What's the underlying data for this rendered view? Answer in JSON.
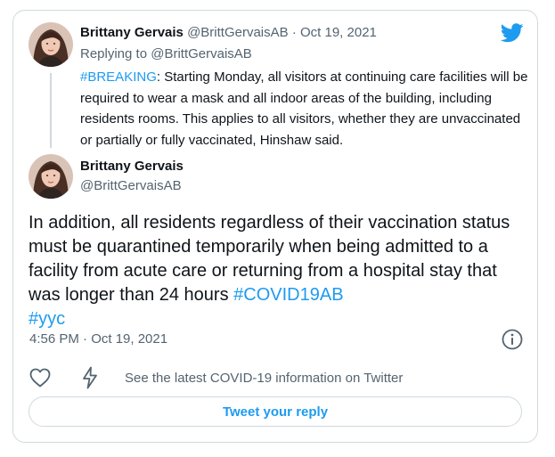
{
  "colors": {
    "accent": "#1d9bf0",
    "text": "#0f1419",
    "muted": "#536471",
    "border": "#cfd9de"
  },
  "parent_tweet": {
    "author_name": "Brittany Gervais",
    "handle": "@BrittGervaisAB",
    "separator": "·",
    "date": "Oct 19, 2021",
    "replying_to_label": "Replying to",
    "replying_to_handle": "@BrittGervaisAB",
    "hashtag": "#BREAKING",
    "text": ": Starting Monday, all visitors at continuing care facilities will be required to wear a mask and all indoor areas of the building, including residents rooms. This applies to all visitors, whether they are unvaccinated or partially or fully vaccinated, Hinshaw said."
  },
  "main_tweet": {
    "author_name": "Brittany Gervais",
    "handle": "@BrittGervaisAB",
    "text": "In addition, all residents regardless of their vaccination status must be quarantined temporarily when being admitted to a facility from acute care or returning from a hospital stay that was longer than 24 hours ",
    "hashtag_1": "#COVID19AB",
    "hashtag_2": "#yyc",
    "timestamp": "4:56 PM · Oct 19, 2021"
  },
  "icons": {
    "brand": "twitter-bird-icon",
    "info": "info-icon",
    "like": "heart-icon",
    "covid": "lightning-bolt-icon"
  },
  "actions": {
    "covid_info_label": "See the latest COVID-19 information on Twitter"
  },
  "reply_button": {
    "label": "Tweet your reply"
  }
}
